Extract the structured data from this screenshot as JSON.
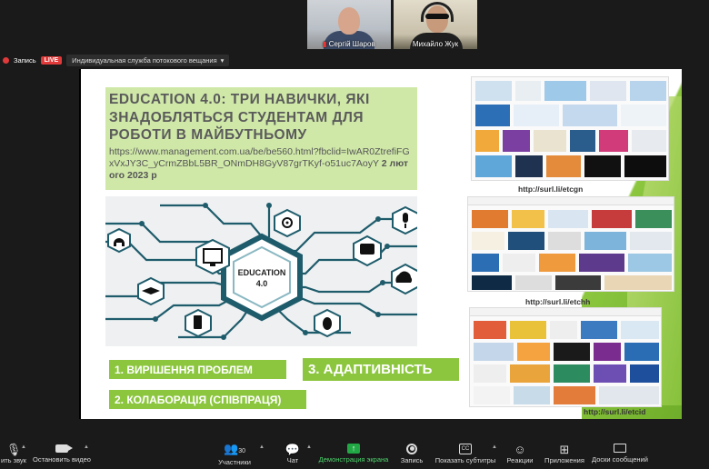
{
  "participants": [
    {
      "name": "Сергій Шаров"
    },
    {
      "name": "Михайло Жук"
    }
  ],
  "topbar": {
    "record_label": "Запись",
    "live_badge": "LIVE",
    "stream_service": "Индивидуальная служба потокового вещания"
  },
  "slide": {
    "title": "EDUCATION 4.0: ТРИ НАВИЧКИ, ЯКІ ЗНАДОБЛЯТЬСЯ СТУДЕНТАМ ДЛЯ РОБОТИ В МАЙБУТНЬОМУ",
    "url": "https://www.management.com.ua/be/be560.html?fbclid=IwAR0ZtrefiFGxVxJY3C_yCrmZBbL5BR_ONmDH8GyV87grTKyf-o51uc7AoyY",
    "date": "2 лютого 2023 р",
    "center_label_top": "EDUCATION",
    "center_label_bottom": "4.0",
    "skill1": "1. ВИРІШЕННЯ ПРОБЛЕМ",
    "skill2": "2. КОЛАБОРАЦІЯ (СПІВПРАЦЯ)",
    "skill3": "3. АДАПТИВНІСТЬ",
    "link1": "http://surl.li/etcgn",
    "link2": "http://surl.li/etchh",
    "link3": "http://surl.li/etcid"
  },
  "toolbar": {
    "mute": "ить звук",
    "stop_video": "Остановить видео",
    "participants": "Участники",
    "participants_count": "30",
    "chat": "Чат",
    "share": "Демонстрация экрана",
    "record": "Запись",
    "captions": "Показать субтитры",
    "cc_icon_text": "CC",
    "reactions": "Реакции",
    "apps": "Приложения",
    "whiteboards": "Доски сообщений"
  },
  "colors": {
    "slide_green": "#8cc63f",
    "title_bg": "#cfe8a8",
    "live_red": "#e03a3a",
    "share_green": "#22a745",
    "hex_teal": "#1f5c6b"
  }
}
